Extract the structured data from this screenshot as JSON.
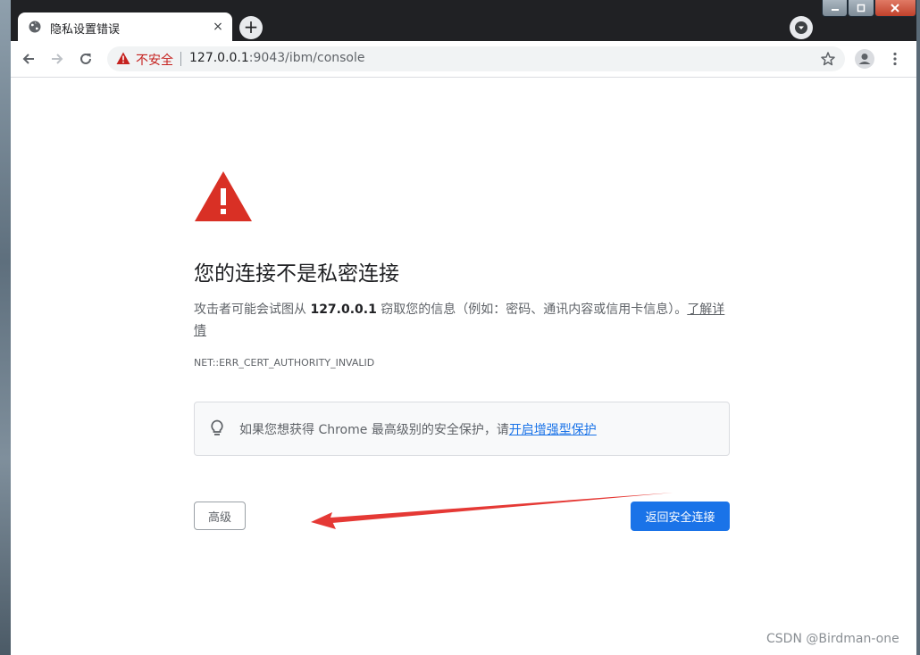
{
  "tab": {
    "title": "隐私设置错误",
    "close_icon": "×",
    "new_tab_icon": "+"
  },
  "toolbar": {
    "security_label": "不安全",
    "url_host": "127.0.0.1",
    "url_path": ":9043/ibm/console"
  },
  "page": {
    "heading": "您的连接不是私密连接",
    "desc_prefix": "攻击者可能会试图从 ",
    "desc_host": "127.0.0.1",
    "desc_suffix": " 窃取您的信息（例如：密码、通讯内容或信用卡信息）。",
    "learn_more": "了解详情",
    "error_code": "NET::ERR_CERT_AUTHORITY_INVALID",
    "enhanced_text": "如果您想获得 Chrome 最高级别的安全保护，请",
    "enhanced_link": "开启增强型保护",
    "advanced_button": "高级",
    "back_button": "返回安全连接"
  },
  "watermark": "CSDN @Birdman-one",
  "colors": {
    "danger": "#c5221f",
    "warning_icon": "#d93025",
    "primary": "#1a73e8",
    "annotation_arrow": "#e53935"
  }
}
